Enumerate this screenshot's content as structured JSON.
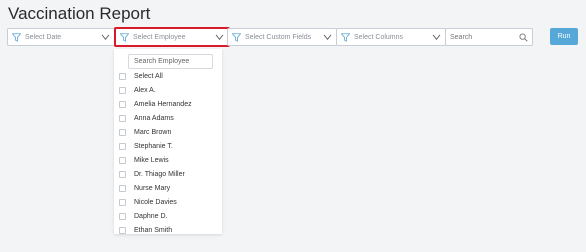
{
  "page": {
    "title": "Vaccination Report"
  },
  "filters": {
    "date": "Select Date",
    "employee": "Select Employee",
    "custom_fields": "Select Custom Fields",
    "columns": "Select Columns"
  },
  "search": {
    "placeholder": "Search"
  },
  "run_label": "Run",
  "dropdown": {
    "search_placeholder": "Search Employee",
    "options": [
      "Select All",
      "Alex A.",
      "Amelia Hernandez",
      "Anna Adams",
      "Marc Brown",
      "Stephanie T.",
      "Mike Lewis",
      "Dr. Thiago Miller",
      "Nurse Mary",
      "Nicole Davies",
      "Daphne D.",
      "Ethan Smith"
    ]
  },
  "colors": {
    "accent": "#56a8d8",
    "highlight": "#d81b27",
    "icon": "#5aa6d6"
  }
}
